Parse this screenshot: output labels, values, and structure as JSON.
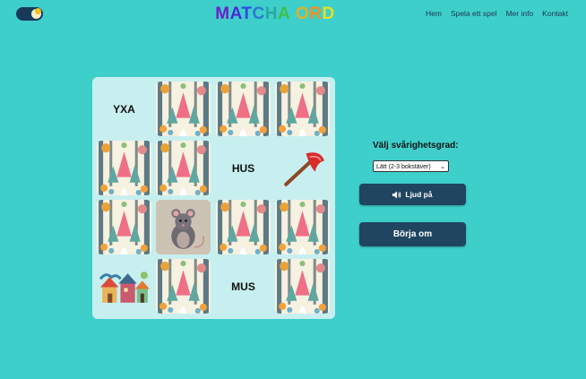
{
  "header": {
    "title_letters": [
      {
        "char": "M",
        "color": "#6a1fc8"
      },
      {
        "char": "A",
        "color": "#4a2bd8"
      },
      {
        "char": "T",
        "color": "#2f47e0"
      },
      {
        "char": "C",
        "color": "#2a78d0"
      },
      {
        "char": "H",
        "color": "#28a7a0"
      },
      {
        "char": "A",
        "color": "#3cbf4a"
      },
      {
        "char": " ",
        "color": "#000000"
      },
      {
        "char": "O",
        "color": "#e0b020"
      },
      {
        "char": "R",
        "color": "#f29020"
      },
      {
        "char": "D",
        "color": "#e8e020"
      }
    ],
    "theme_toggle_icon": "moon-icon"
  },
  "nav": {
    "items": [
      "Hem",
      "Spela ett spel",
      "Mer info",
      "Kontakt"
    ]
  },
  "board": {
    "tiles": [
      {
        "type": "word",
        "label": "YXA"
      },
      {
        "type": "back"
      },
      {
        "type": "back"
      },
      {
        "type": "back"
      },
      {
        "type": "back"
      },
      {
        "type": "back"
      },
      {
        "type": "word",
        "label": "HUS"
      },
      {
        "type": "image",
        "icon": "axe-icon"
      },
      {
        "type": "back"
      },
      {
        "type": "image",
        "icon": "mouse-icon"
      },
      {
        "type": "back"
      },
      {
        "type": "back"
      },
      {
        "type": "image",
        "icon": "houses-icon"
      },
      {
        "type": "back"
      },
      {
        "type": "word",
        "label": "MUS"
      },
      {
        "type": "back"
      }
    ]
  },
  "panel": {
    "difficulty_label": "Välj svårighetsgrad:",
    "difficulty_selected": "Lätt (2-3 bokstäver)",
    "sound_button": "Ljud på",
    "sound_icon": "speaker-icon",
    "restart_button": "Börja om"
  }
}
